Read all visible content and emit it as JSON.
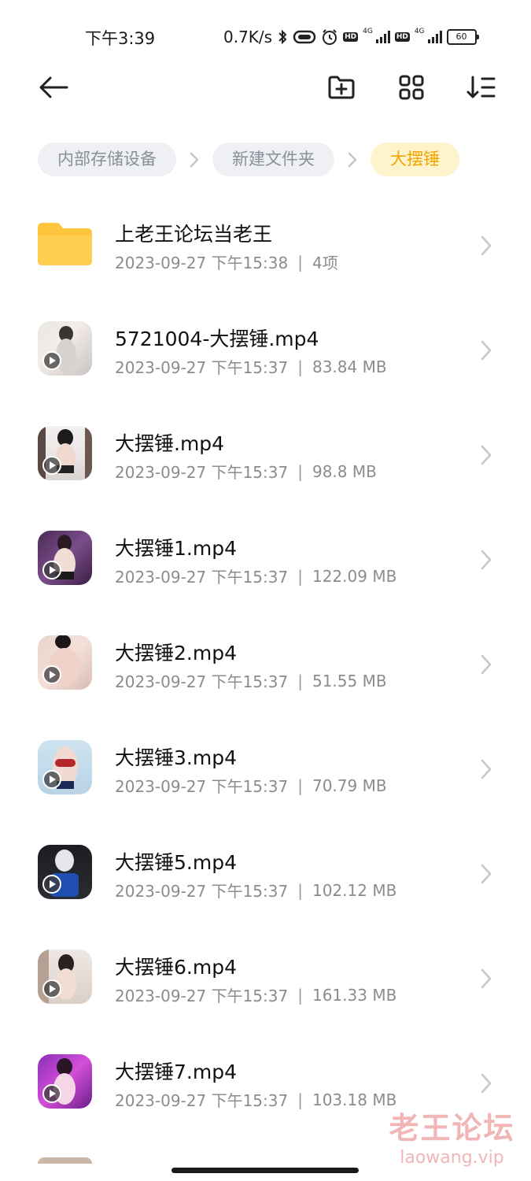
{
  "status_bar": {
    "time": "下午3:39",
    "net_speed": "0.7K/s",
    "hd1": "HD",
    "net1": "4G",
    "hd2": "HD",
    "net2": "4G",
    "battery": "60"
  },
  "toolbar": {
    "back_icon": "arrow-left-icon",
    "new_folder_icon": "folder-plus-icon",
    "grid_icon": "grid-view-icon",
    "sort_icon": "sort-icon"
  },
  "breadcrumb": {
    "items": [
      {
        "label": "内部存储设备"
      },
      {
        "label": "新建文件夹"
      },
      {
        "label": "大摆锤"
      }
    ]
  },
  "colors": {
    "folder": "#ffc53d",
    "active_crumb_bg": "#fff3cc",
    "active_crumb_text": "#f0a400",
    "crumb_bg": "#eef0f4"
  },
  "files": [
    {
      "name": "上老王论坛当老王",
      "date": "2023-09-27 下午15:38",
      "size": "4项",
      "type": "folder"
    },
    {
      "name": "5721004-大摆锤.mp4",
      "date": "2023-09-27 下午15:37",
      "size": "83.84 MB",
      "type": "video"
    },
    {
      "name": "大摆锤.mp4",
      "date": "2023-09-27 下午15:37",
      "size": "98.8 MB",
      "type": "video"
    },
    {
      "name": "大摆锤1.mp4",
      "date": "2023-09-27 下午15:37",
      "size": "122.09 MB",
      "type": "video"
    },
    {
      "name": "大摆锤2.mp4",
      "date": "2023-09-27 下午15:37",
      "size": "51.55 MB",
      "type": "video"
    },
    {
      "name": "大摆锤3.mp4",
      "date": "2023-09-27 下午15:37",
      "size": "70.79 MB",
      "type": "video"
    },
    {
      "name": "大摆锤5.mp4",
      "date": "2023-09-27 下午15:37",
      "size": "102.12 MB",
      "type": "video"
    },
    {
      "name": "大摆锤6.mp4",
      "date": "2023-09-27 下午15:37",
      "size": "161.33 MB",
      "type": "video"
    },
    {
      "name": "大摆锤7.mp4",
      "date": "2023-09-27 下午15:37",
      "size": "103.18 MB",
      "type": "video"
    }
  ],
  "meta_separator": "|",
  "watermark": {
    "line1": "老王论坛",
    "line2": "laowang.vip"
  }
}
